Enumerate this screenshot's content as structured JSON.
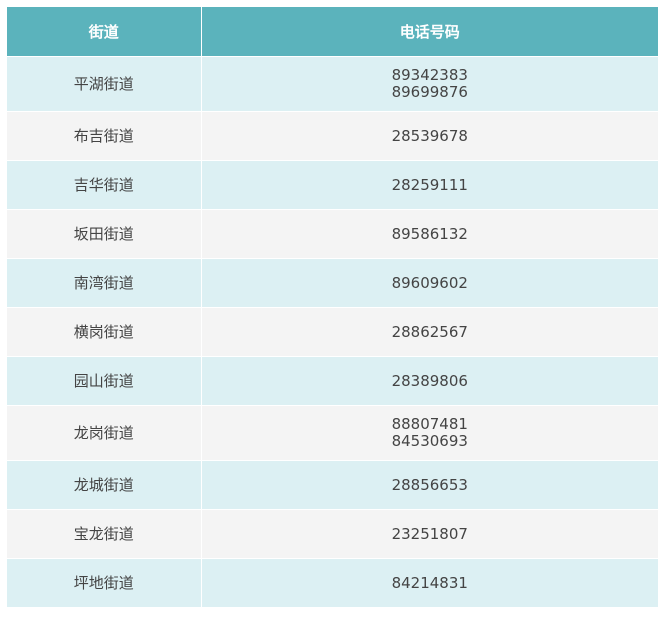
{
  "table": {
    "headers": [
      "街道",
      "电话号码"
    ],
    "rows": [
      {
        "street": "平湖街道",
        "phones": [
          "89342383",
          "89699876"
        ]
      },
      {
        "street": "布吉街道",
        "phones": [
          "28539678"
        ]
      },
      {
        "street": "吉华街道",
        "phones": [
          "28259111"
        ]
      },
      {
        "street": "坂田街道",
        "phones": [
          "89586132"
        ]
      },
      {
        "street": "南湾街道",
        "phones": [
          "89609602"
        ]
      },
      {
        "street": "横岗街道",
        "phones": [
          "28862567"
        ]
      },
      {
        "street": "园山街道",
        "phones": [
          "28389806"
        ]
      },
      {
        "street": "龙岗街道",
        "phones": [
          "88807481",
          "84530693"
        ]
      },
      {
        "street": "龙城街道",
        "phones": [
          "28856653"
        ]
      },
      {
        "street": "宝龙街道",
        "phones": [
          "23251807"
        ]
      },
      {
        "street": "坪地街道",
        "phones": [
          "84214831"
        ]
      }
    ]
  },
  "colors": {
    "header_bg": "#5bb3bc",
    "row_odd_bg": "#dcf0f3",
    "row_even_bg": "#f4f4f4",
    "text": "#444444"
  }
}
